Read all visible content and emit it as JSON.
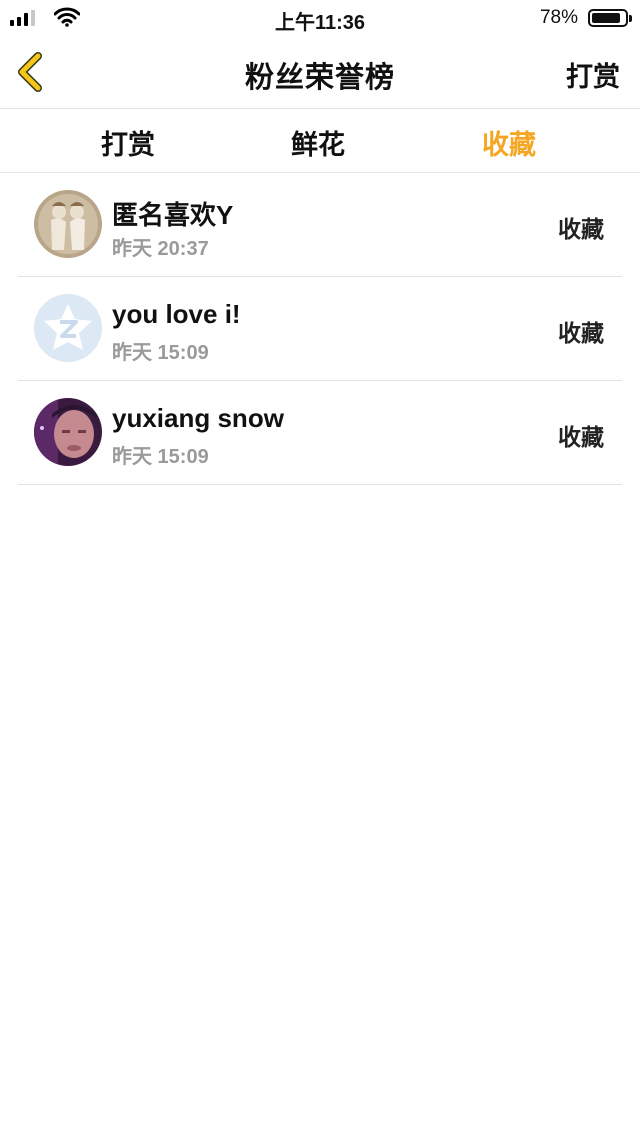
{
  "status": {
    "time": "上午11:36",
    "battery": "78%"
  },
  "nav": {
    "title": "粉丝荣誉榜",
    "right": "打赏"
  },
  "tabs": [
    {
      "label": "打赏",
      "active": false
    },
    {
      "label": "鲜花",
      "active": false
    },
    {
      "label": "收藏",
      "active": true
    }
  ],
  "list": [
    {
      "name": "匿名喜欢Y",
      "time": "昨天 20:37",
      "action": "收藏",
      "avatar": "avatar-dolls-icon"
    },
    {
      "name": "you love i!",
      "time": "昨天 15:09",
      "action": "收藏",
      "avatar": "avatar-default-qq-icon"
    },
    {
      "name": "yuxiang snow",
      "time": "昨天 15:09",
      "action": "收藏",
      "avatar": "avatar-photo-icon"
    }
  ],
  "colors": {
    "accent": "#F5A623",
    "back_arrow": "#F5C518"
  }
}
